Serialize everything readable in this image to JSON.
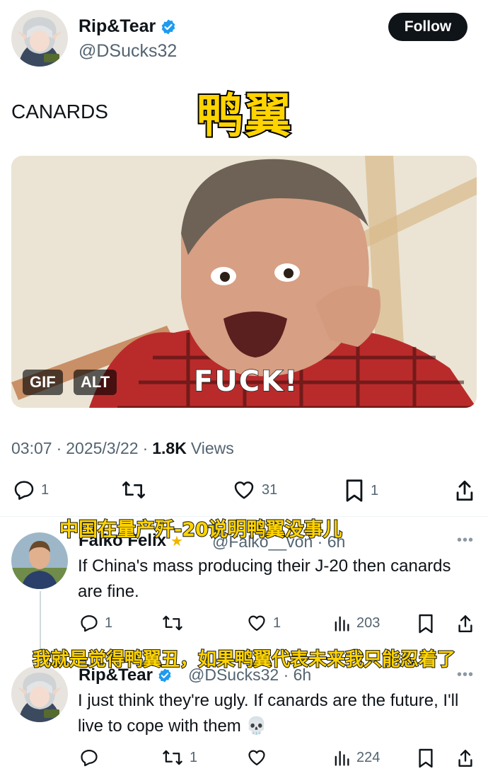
{
  "post": {
    "author_name": "Rip&Tear",
    "author_handle": "@DSucks32",
    "follow_label": "Follow",
    "text": "CANARDS",
    "caption_overlay": "鸭翼",
    "media": {
      "gif_badge": "GIF",
      "alt_badge": "ALT",
      "gif_caption": "FUCK!"
    },
    "time": "03:07",
    "date": "2025/3/22",
    "views_count": "1.8K",
    "views_label": "Views",
    "replies": "1",
    "reposts": "",
    "likes": "31",
    "bookmarks": "1"
  },
  "reply1": {
    "caption_overlay": "中国在量产歼-20说明鸭翼没事儿",
    "author_name": "Falko Felix",
    "author_handle": "@Falko__von",
    "time": "6h",
    "text": "If China's mass producing their J-20 then canards are fine.",
    "replies": "1",
    "reposts": "",
    "likes": "1",
    "views": "203"
  },
  "reply2": {
    "caption_overlay": "我就是觉得鸭翼丑，如果鸭翼代表未来我只能忍着了",
    "author_name": "Rip&Tear",
    "author_handle": "@DSucks32",
    "time": "6h",
    "text": "I just think they're ugly. If canards are the future, I'll live to cope with them 💀",
    "replies": "",
    "reposts": "1",
    "likes": "",
    "views": "224"
  },
  "colors": {
    "accent": "#1d9bf0",
    "muted": "#536471",
    "caption_yellow": "#ffd400"
  }
}
